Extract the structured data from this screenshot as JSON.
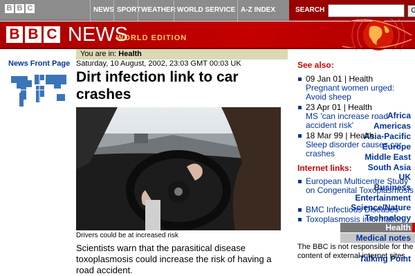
{
  "topbar": {
    "logo_letters": [
      "B",
      "B",
      "C"
    ],
    "nav": [
      "NEWS",
      "SPORT",
      "WEATHER",
      "WORLD SERVICE",
      "A-Z INDEX"
    ],
    "search_label": "SEARCH",
    "search_value": "",
    "go_label": "Go"
  },
  "banner": {
    "logo_letters": [
      "B",
      "B",
      "C"
    ],
    "news": "NEWS",
    "edition": "WORLD EDITION"
  },
  "leftnav": {
    "front_page": "News Front Page",
    "items": [
      "Africa",
      "Americas",
      "Asia-Pacific",
      "Europe",
      "Middle East",
      "South Asia",
      "UK",
      "Business",
      "Entertainment",
      "Science/Nature",
      "Technology",
      "Health",
      "Medical notes",
      "Talking Point"
    ]
  },
  "article": {
    "breadcrumb_prefix": "You are in:",
    "breadcrumb_section": "Health",
    "dateline": "Saturday, 10 August, 2002, 23:03 GMT 00:03 UK",
    "headline": "Dirt infection link to car crashes",
    "caption": "Drivers could be at increased risk",
    "intro": "Scientists warn that the parasitical disease toxoplasmosis could increase the risk of having a road accident."
  },
  "see_also": {
    "heading": "See also:",
    "items": [
      {
        "meta": "09 Jan 01 | Health",
        "title": "Pregnant women urged: Avoid sheep"
      },
      {
        "meta": "23 Apr 01 | Health",
        "title": "MS 'can increase road accident risk'"
      },
      {
        "meta": "18 Mar 99 | Health",
        "title": "Sleep disorder causes car crashes"
      }
    ]
  },
  "internet_links": {
    "heading": "Internet links:",
    "items": [
      "European Multicentre Study on Congenital Toxoplasmosis",
      "BMC Infectious Diseases",
      "Toxoplasmosis information"
    ]
  },
  "disclaimer": "The BBC is not responsible for the content of external internet sites",
  "colors": {
    "bbc_red": "#b00000",
    "link_blue": "#003399",
    "heading_red": "#cc0000",
    "breadcrumb_bg": "#d9d9b4"
  }
}
